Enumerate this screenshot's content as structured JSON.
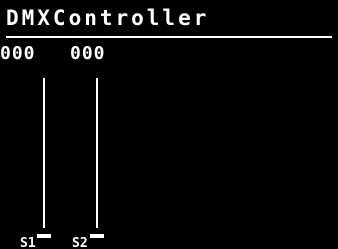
{
  "app": {
    "title": "DMXController"
  },
  "channels": [
    {
      "value": "000",
      "label": "S1",
      "level": 0
    },
    {
      "value": "000",
      "label": "S2",
      "level": 0
    }
  ],
  "colors": {
    "background": "#000000",
    "foreground": "#ffffff"
  }
}
